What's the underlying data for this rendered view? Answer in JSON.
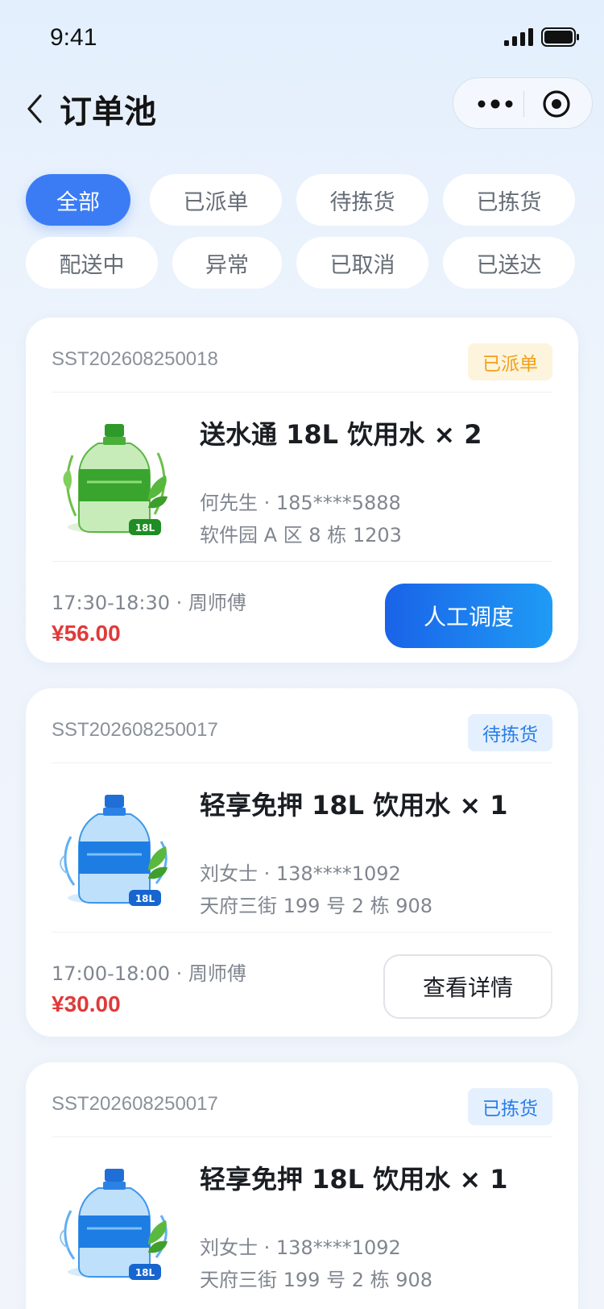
{
  "status_bar": {
    "time": "9:41"
  },
  "nav": {
    "title": "订单池",
    "back_icon": "chevron-left-icon",
    "more_icon": "more-dots-icon",
    "close_icon": "target-circle-icon"
  },
  "filters": [
    {
      "label": "全部",
      "active": true
    },
    {
      "label": "已派单",
      "active": false
    },
    {
      "label": "待拣货",
      "active": false
    },
    {
      "label": "已拣货",
      "active": false
    },
    {
      "label": "配送中",
      "active": false
    },
    {
      "label": "异常",
      "active": false
    },
    {
      "label": "已取消",
      "active": false
    },
    {
      "label": "已送达",
      "active": false
    }
  ],
  "colors": {
    "accent": "#3b7cf5",
    "price": "#e03a3a",
    "badge_orange": "#f3a01a",
    "badge_blue": "#2a7ee8"
  },
  "orders": [
    {
      "order_no": "SST202608250018",
      "status": "已派单",
      "product_title": "送水通 18L 饮用水 × 2",
      "product_icon": "green-water-bottle-icon",
      "bottle_tag": "18L",
      "customer": "何先生 · 185****5888",
      "address": "软件园 A 区 8 栋 1203",
      "time_slot": "17:30-18:30 · 周师傅",
      "price": "¥56.00",
      "action": "人工调度"
    },
    {
      "order_no": "SST202608250017",
      "status": "待拣货",
      "product_title": "轻享免押 18L 饮用水 × 1",
      "product_icon": "blue-water-bottle-icon",
      "bottle_tag": "18L",
      "customer": "刘女士 · 138****1092",
      "address": "天府三街 199 号 2 栋 908",
      "time_slot": "17:00-18:00 · 周师傅",
      "price": "¥30.00",
      "action": "查看详情"
    },
    {
      "order_no": "SST202608250017",
      "status": "已拣货",
      "product_title": "轻享免押 18L 饮用水 × 1",
      "product_icon": "blue-water-bottle-icon",
      "bottle_tag": "18L",
      "customer": "刘女士 · 138****1092",
      "address": "天府三街 199 号 2 栋 908"
    }
  ]
}
